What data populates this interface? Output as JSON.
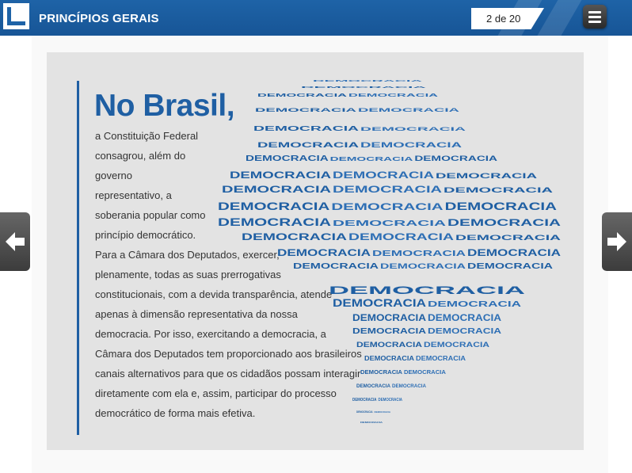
{
  "header": {
    "title": "PRINCÍPIOS GERAIS",
    "page_indicator": "2 de 20",
    "logo_icon": "camara-logo-icon",
    "menu_icon": "hamburger-icon"
  },
  "slide": {
    "heading": "No Brasil,",
    "lines": [
      "a Constituição Federal",
      "consagrou, além do",
      "governo",
      "representativo, a",
      "soberania popular como",
      "princípio democrático.",
      "Para a Câmara dos Deputados, exercer,",
      "plenamente, todas as suas prerrogativas",
      "constitucionais, com a devida transparência, atende",
      "apenas à dimensão representativa da nossa",
      "democracia.  Por isso, exercitando a democracia, a",
      "Câmara dos Deputados tem proporcionado aos brasileiros",
      "canais alternativos para que os cidadãos possam interagir",
      "diretamente com ela e, assim, participar do processo",
      "democrático de forma mais efetiva."
    ],
    "map_word": "DEMOCRACIA"
  },
  "navigation": {
    "prev_icon": "arrow-left-icon",
    "next_icon": "arrow-right-icon"
  },
  "colors": {
    "header_blue": "#1e63a7",
    "accent_blue": "#1f5fa3",
    "panel_gray": "#e3e3e3"
  }
}
